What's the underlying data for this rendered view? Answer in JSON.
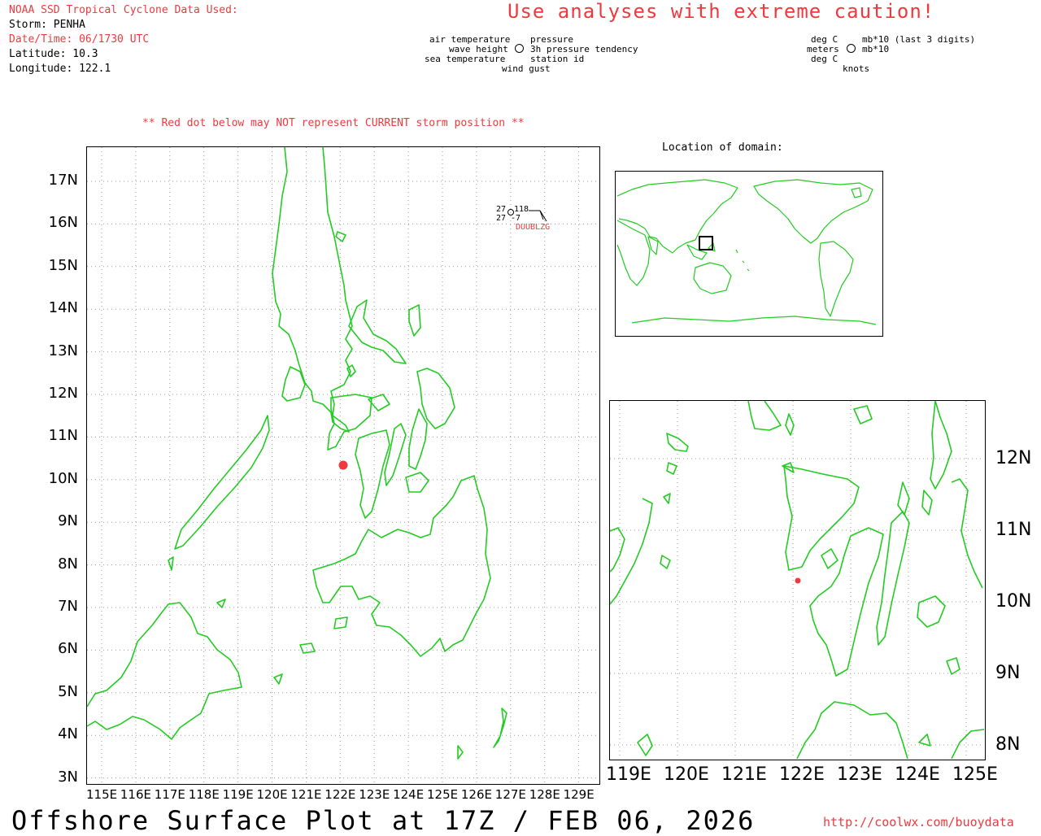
{
  "header": {
    "source_title": "NOAA SSD Tropical Cyclone Data Used:",
    "storm": "Storm: PENHA",
    "datetime": "Date/Time: 06/1730 UTC",
    "latitude": "Latitude: 10.3",
    "longitude": "Longitude: 122.1",
    "caution": "Use analyses with extreme caution!",
    "red_dot_warning": "** Red dot below may NOT represent CURRENT storm position **"
  },
  "legend_left": {
    "air_temperature": "air temperature",
    "pressure": "pressure",
    "wave_height": "wave height",
    "pressure_tendency": "3h pressure tendency",
    "sea_temperature": "sea temperature",
    "station_id": "station id",
    "wind_gust": "wind gust"
  },
  "legend_right": {
    "deg_c_1": "deg C",
    "mb_last3": "mb*10 (last 3 digits)",
    "meters": "meters",
    "mb_10": "mb*10",
    "deg_c_2": "deg C",
    "knots": "knots"
  },
  "station": {
    "air_temp": "27",
    "pressure": "118",
    "sea_temp": "27",
    "tendency": "-7",
    "id": "DUUBLZG"
  },
  "inset": {
    "title": "Location of domain:"
  },
  "main_map": {
    "lat_labels": [
      "17N",
      "16N",
      "15N",
      "14N",
      "13N",
      "12N",
      "11N",
      "10N",
      "9N",
      "8N",
      "7N",
      "6N",
      "5N",
      "4N",
      "3N"
    ],
    "lon_labels": [
      "115E",
      "116E",
      "117E",
      "118E",
      "119E",
      "120E",
      "121E",
      "122E",
      "123E",
      "124E",
      "125E",
      "126E",
      "127E",
      "128E",
      "129E"
    ]
  },
  "zoom_map": {
    "lat_labels": [
      "12N",
      "11N",
      "10N",
      "9N",
      "8N"
    ],
    "lon_labels": [
      "119E",
      "120E",
      "121E",
      "122E",
      "123E",
      "124E",
      "125E"
    ]
  },
  "colors": {
    "coastline": "#22cc22",
    "storm_dot": "#f0393e",
    "warning_text": "#f0393e"
  },
  "footer": {
    "title": "Offshore Surface Plot at 17Z / FEB 06, 2026",
    "url": "http://coolwx.com/buoydata"
  }
}
